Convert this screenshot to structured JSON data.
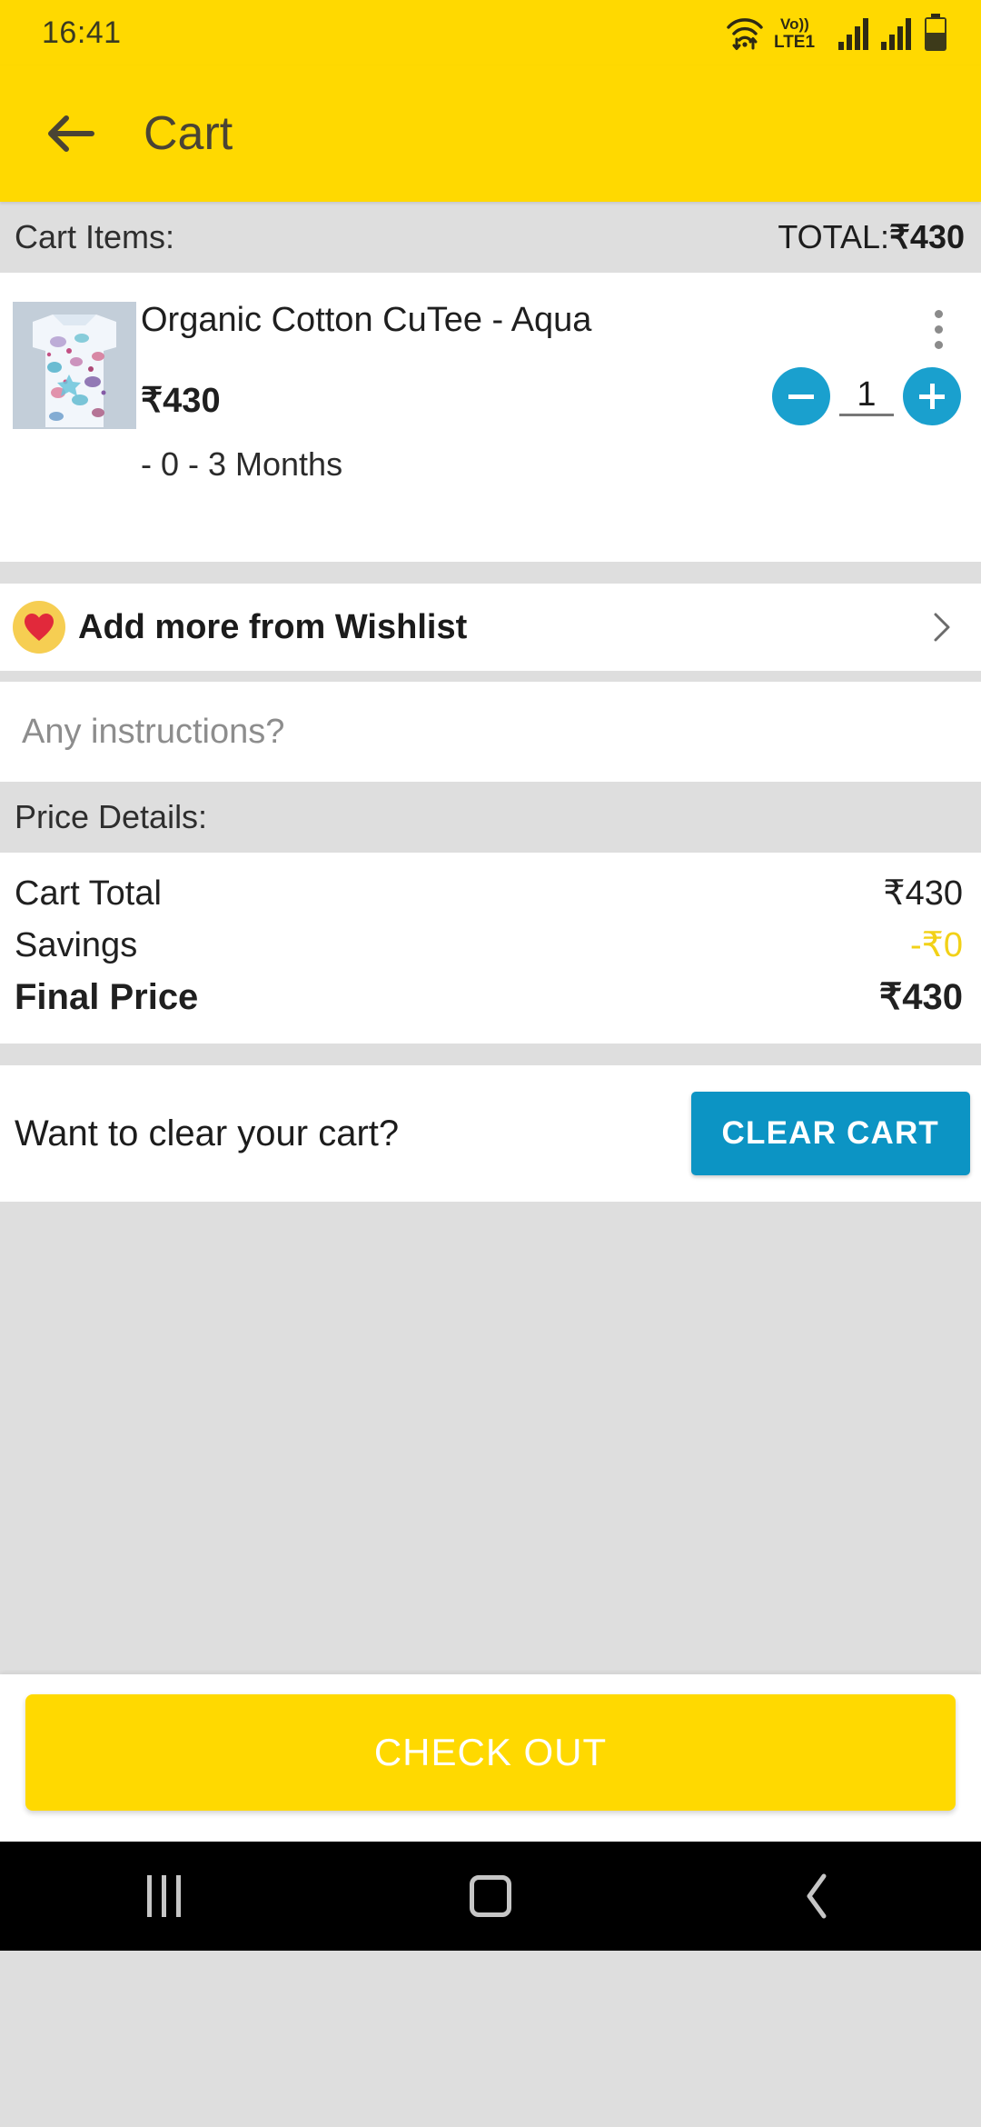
{
  "status_bar": {
    "time": "16:41",
    "icons": [
      "wifi-icon",
      "volte-icon",
      "signal-sim1-icon",
      "signal-sim2-icon",
      "battery-icon"
    ],
    "volte_top": "Vo))",
    "volte_bottom": "LTE1"
  },
  "app_bar": {
    "back_label": "back-arrow",
    "title": "Cart",
    "bg_color": "#FFD900",
    "title_color": "#4a4434"
  },
  "cart_header": {
    "label": "Cart Items:",
    "total_label": "TOTAL:",
    "total_value": "₹430"
  },
  "cart_items": [
    {
      "title": "Organic Cotton CuTee - Aqua",
      "price": "₹430",
      "variant": "- 0 - 3 Months",
      "quantity": "1",
      "decrease_label": "minus-icon",
      "increase_label": "plus-icon",
      "menu_label": "kebab-menu-icon"
    }
  ],
  "wishlist": {
    "label": "Add more from Wishlist",
    "icon": "heart-icon",
    "chevron": "chevron-right-icon"
  },
  "instructions": {
    "value": "",
    "placeholder": "Any instructions?"
  },
  "price_details": {
    "heading": "Price Details:",
    "rows": [
      {
        "label": "Cart Total",
        "value": "₹430"
      },
      {
        "label": "Savings",
        "value": "-₹0"
      },
      {
        "label": "Final Price",
        "value": "₹430"
      }
    ]
  },
  "clear_cart": {
    "question": "Want to clear your cart?",
    "button_label": "CLEAR CART",
    "button_color": "#0C94C4"
  },
  "checkout": {
    "label": "CHECK OUT",
    "color": "#FFD900"
  },
  "nav_bar": {
    "recents": "recents-icon",
    "home": "home-icon",
    "back": "back-icon"
  },
  "colors": {
    "brand_yellow": "#FFD900",
    "accent_blue": "#1AA0CE",
    "clear_blue": "#0C94C4",
    "savings_yellow": "#F2D117",
    "page_bg": "#dedede"
  }
}
